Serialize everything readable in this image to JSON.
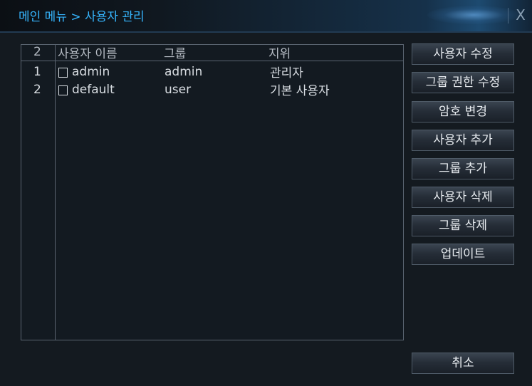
{
  "window": {
    "title": "메인 메뉴 > 사용자 관리",
    "close_label": "X"
  },
  "table": {
    "header": {
      "count": "2",
      "username": "사용자 이름",
      "group": "그룹",
      "role": "지위"
    },
    "rows": [
      {
        "index": "1",
        "username": "admin",
        "group": "admin",
        "role": "관리자"
      },
      {
        "index": "2",
        "username": "default",
        "group": "user",
        "role": "기본 사용자"
      }
    ]
  },
  "buttons": {
    "edit_user": "사용자 수정",
    "edit_group_rights": "그룹 권한 수정",
    "change_password": "암호 변경",
    "add_user": "사용자 추가",
    "add_group": "그룹 추가",
    "delete_user": "사용자 삭제",
    "delete_group": "그룹 삭제",
    "update": "업데이트",
    "cancel": "취소"
  },
  "colors": {
    "title_text": "#36b6ff",
    "background": "#141a20",
    "button_text": "#e8ecf0"
  }
}
